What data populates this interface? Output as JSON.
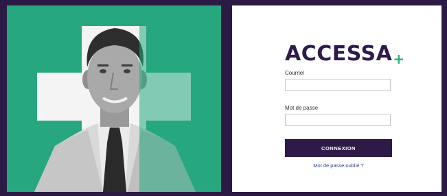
{
  "brand": {
    "name": "ACCESSA",
    "plus": "+"
  },
  "form": {
    "email_label": "Courriel",
    "email_value": "",
    "password_label": "Mot de passe",
    "password_value": "",
    "submit_label": "CONNEXION",
    "forgot_link": "Mot de passe oublié ?"
  },
  "colors": {
    "frame": "#2b1a44",
    "hero_green": "#27a77f",
    "brand_purple": "#2e1b4d",
    "brand_green": "#22b07c",
    "button": "#2e1a47",
    "link": "#2f3f8a"
  },
  "hero": {
    "icon": "medical-cross-icon",
    "subject": "doctor-portrait"
  }
}
